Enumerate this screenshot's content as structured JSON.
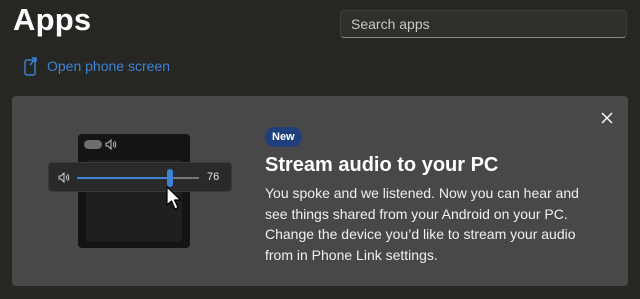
{
  "header": {
    "title": "Apps",
    "search_placeholder": "Search apps",
    "open_phone_label": "Open phone screen"
  },
  "banner": {
    "badge": "New",
    "title": "Stream audio to your PC",
    "description": "You spoke and we listened. Now you can hear and see things shared from your Android on your PC. Change the device you’d like to stream your audio from in Phone Link settings.",
    "close_icon": "close-icon",
    "illustration": {
      "volume_value": "76",
      "volume_level": 0.76,
      "icons": [
        "speaker-icon",
        "cursor-icon"
      ]
    }
  },
  "colors": {
    "background": "#262622",
    "banner": "#484848",
    "accent": "#3d84d6",
    "badge": "#1f3f7c"
  }
}
